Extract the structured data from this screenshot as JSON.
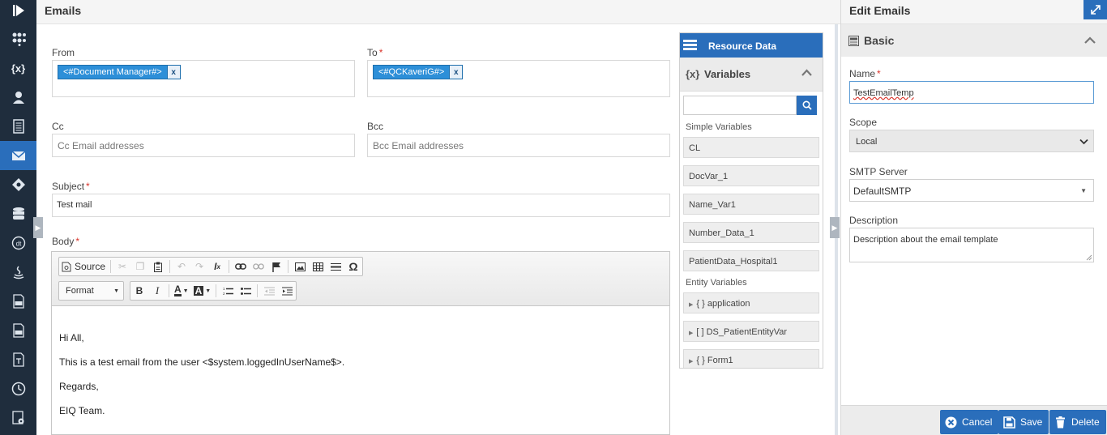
{
  "header": {
    "title": "Emails"
  },
  "nav": {
    "icons": [
      "play-logo-icon",
      "dashboard-icon",
      "variables-icon",
      "user-icon",
      "document-icon",
      "email-icon",
      "diamond-icon",
      "database-icon",
      "dt-icon",
      "java-icon",
      "file-xls-icon",
      "file-csv-icon",
      "file-text-icon",
      "clock-icon",
      "settings-doc-icon"
    ]
  },
  "form": {
    "from": {
      "label": "From",
      "chip": "<#Document Manager#>",
      "chip_remove": "x"
    },
    "to": {
      "label": "To",
      "required_mark": "*",
      "chip": "<#QCKaveriG#>",
      "chip_remove": "x"
    },
    "cc": {
      "label": "Cc",
      "placeholder": "Cc Email addresses"
    },
    "bcc": {
      "label": "Bcc",
      "placeholder": "Bcc Email addresses"
    },
    "subject": {
      "label": "Subject",
      "required_mark": "*",
      "value": "Test mail"
    },
    "body": {
      "label": "Body",
      "required_mark": "*",
      "toolbar": {
        "source": "Source",
        "format": "Format",
        "omega": "Ω"
      },
      "lines": [
        "Hi All,",
        "This is a test email from the user <$system.loggedInUserName$>.",
        "Regards,",
        "EIQ Team."
      ]
    }
  },
  "resource": {
    "title": "Resource Data",
    "variables_title": "Variables",
    "variables_icon": "{x}",
    "simple_label": "Simple Variables",
    "simple": [
      "CL",
      "DocVar_1",
      "Name_Var1",
      "Number_Data_1",
      "PatientData_Hospital1"
    ],
    "entity_label": "Entity Variables",
    "entity": [
      "{ } application",
      "[ ] DS_PatientEntityVar",
      "{ } Form1"
    ]
  },
  "panel": {
    "title": "Edit Emails",
    "section": "Basic",
    "name_label": "Name",
    "name_value": "TestEmailTemp",
    "scope_label": "Scope",
    "scope_value": "Local",
    "smtp_label": "SMTP Server",
    "smtp_value": "DefaultSMTP",
    "desc_label": "Description",
    "desc_value": "Description about the email template",
    "cancel": "Cancel",
    "save": "Save",
    "delete": "Delete"
  },
  "colors": {
    "accent": "#2a6ebb",
    "nav_bg": "#1f2d3d",
    "chip": "#2d8fd8",
    "required": "#d9342b"
  }
}
